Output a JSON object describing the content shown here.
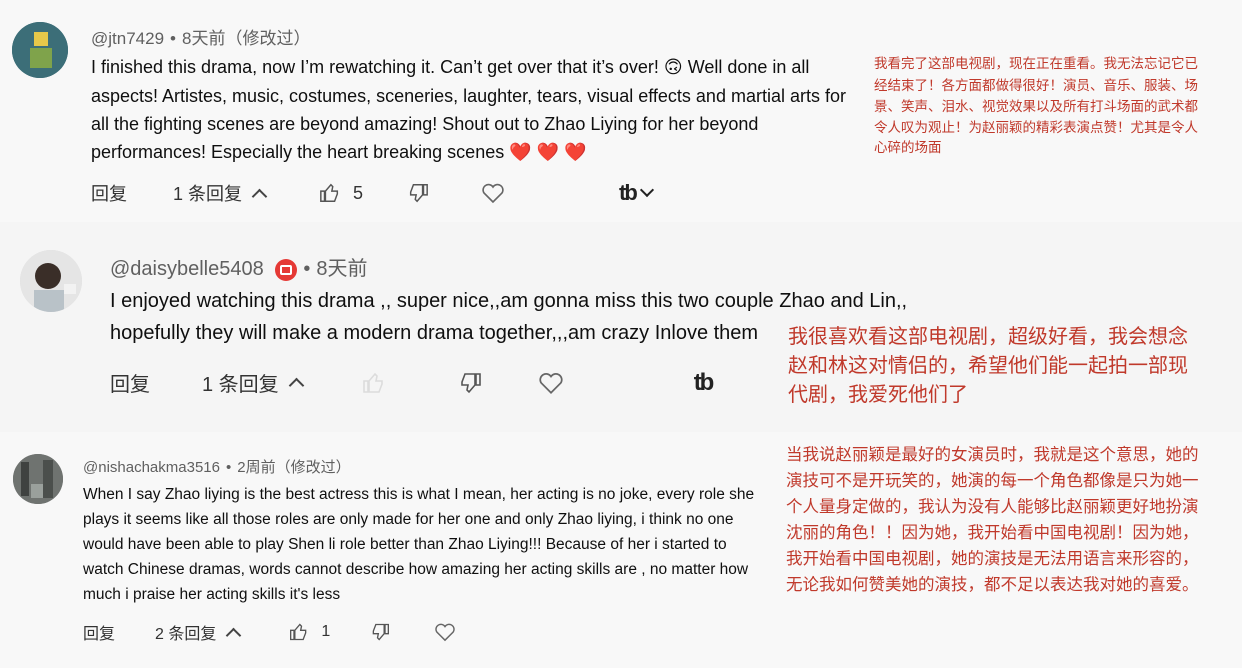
{
  "comments": [
    {
      "author": "@jtn7429",
      "time": "8天前（修改过）",
      "lines": [
        "I finished this drama, now I’m rewatching it.  Can’t get over that it’s over! 🙃 Well done in all",
        "aspects!  Artistes, music, costumes, sceneries, laughter, tears, visual effects and martial arts for",
        "all the fighting scenes are beyond amazing! Shout out to Zhao Liying for her beyond",
        "performances! Especially the heart breaking scenes ❤️ ❤️ ❤️"
      ],
      "reply_label": "回复",
      "reply_count": "1 条回复",
      "likes": "5",
      "note_lines": [
        "我看完了这部电视剧，现在正在重看。我无法忘记它已",
        "经结束了！各方面都做得很好！演员、音乐、服装、场",
        "景、笑声、泪水、视觉效果以及所有打斗场面的武术都",
        "令人叹为观止！为赵丽颖的精彩表演点赞！尤其是令人",
        "心碎的场面"
      ]
    },
    {
      "author": "@daisybelle5408",
      "time": "8天前",
      "lines": [
        "I enjoyed watching this drama ,, super nice,,am gonna miss this two couple Zhao and Lin,,",
        "hopefully they will make a modern drama together,,,am crazy Inlove them"
      ],
      "reply_label": "回复",
      "reply_count": "1 条回复",
      "note_lines": [
        "我很喜欢看这部电视剧，超级好看，我会想念",
        "赵和林这对情侣的，希望他们能一起拍一部现",
        "代剧，我爱死他们了"
      ]
    },
    {
      "author": "@nishachakma3516",
      "time": "2周前（修改过）",
      "lines": [
        "When I say Zhao liying is the best actress this is what I mean, her acting is no joke, every role she",
        "plays it seems like all those roles are only made for her one and only Zhao liying, i think no one",
        "would have been able to play Shen li role better than Zhao Liying!!! Because of her i started to",
        "watch Chinese dramas, words cannot describe how amazing her acting skills are , no matter how",
        "much i praise her acting skills it's less"
      ],
      "reply_label": "回复",
      "reply_count": "2 条回复",
      "likes": "1",
      "note_lines": [
        "当我说赵丽颖是最好的女演员时，我就是这个意思，她的",
        "演技可不是开玩笑的，她演的每一个角色都像是只为她一",
        "个人量身定做的，我认为没有人能够比赵丽颖更好地扮演",
        "沈丽的角色！！因为她，我开始看中国电视剧！因为她，",
        "我开始看中国电视剧，她的演技是无法用语言来形容的，",
        "无论我如何赞美她的演技，都不足以表达我对她的喜爱。"
      ]
    }
  ],
  "icons": {
    "like": "thumbs-up-icon",
    "dislike": "thumbs-down-icon",
    "heart": "heart-icon",
    "translate": "tb-logo-icon"
  }
}
